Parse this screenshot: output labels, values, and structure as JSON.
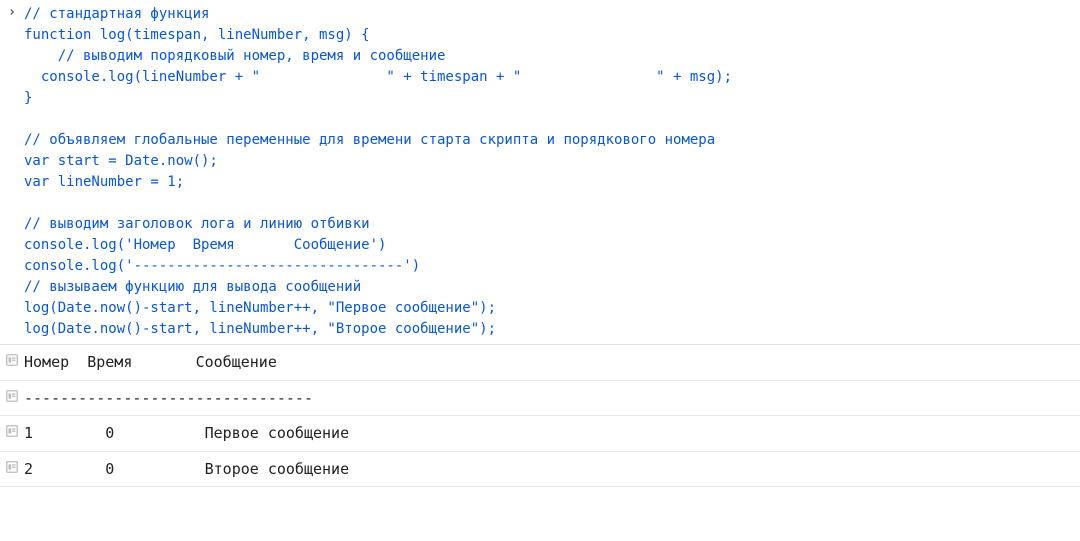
{
  "input": {
    "code": "// стандартная функция\nfunction log(timespan, lineNumber, msg) {\n    // выводим порядковый номер, время и сообщение\n  console.log(lineNumber + \"               \" + timespan + \"                \" + msg);\n}\n\n// объявляем глобальные переменные для времени старта скрипта и порядкового номера\nvar start = Date.now();\nvar lineNumber = 1;\n\n// выводим заголовок лога и линию отбивки\nconsole.log('Номер  Время       Сообщение')\nconsole.log('--------------------------------')\n// вызываем функцию для вывода сообщений\nlog(Date.now()-start, lineNumber++, \"Первое сообщение\");\nlog(Date.now()-start, lineNumber++, \"Второе сообщение\");"
  },
  "output": {
    "rows": [
      "Номер  Время       Сообщение",
      "--------------------------------",
      "1        0          Первое сообщение",
      "2        0          Второе сообщение"
    ]
  }
}
